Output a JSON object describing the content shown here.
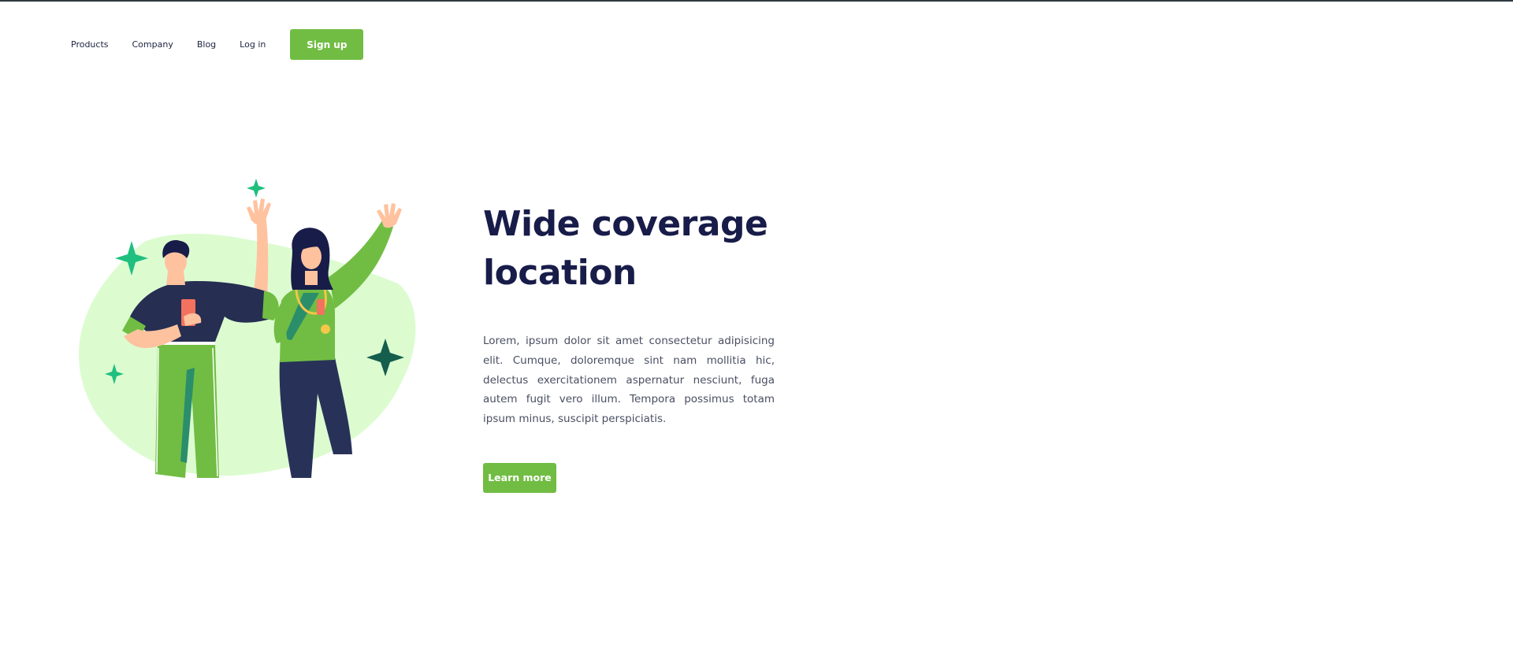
{
  "nav": {
    "items": [
      {
        "label": "Products"
      },
      {
        "label": "Company"
      },
      {
        "label": "Blog"
      },
      {
        "label": "Log in"
      }
    ],
    "signup_label": "Sign up"
  },
  "hero": {
    "title_line1": "Wide coverage",
    "title_line2": "location",
    "body": "Lorem, ipsum dolor sit amet consectetur adipisicing elit. Cumque, doloremque sint nam mollitia hic, delectus exercitationem aspernatur nesciunt, fuga autem fugit vero illum. Tempora possimus totam ipsum minus, suscipit perspiciatis.",
    "cta_label": "Learn more"
  },
  "colors": {
    "accent": "#71bd43",
    "title": "#181c49",
    "blob": "#dcfcd0"
  }
}
